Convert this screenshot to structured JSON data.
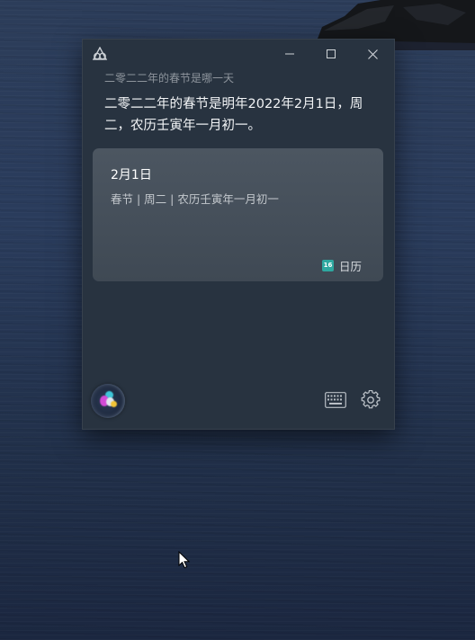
{
  "assistant": {
    "query": "二零二二年的春节是哪一天",
    "answer": "二零二二年的春节是明年2022年2月1日，周二，农历壬寅年一月初一。",
    "card": {
      "date": "2月1日",
      "detail": "春节 | 周二 | 农历壬寅年一月初一",
      "source_label": "日历",
      "source_icon_text": "16"
    }
  },
  "icons": {
    "app": "assistant-logo-icon",
    "minimize": "minimize-icon",
    "maximize": "maximize-icon",
    "close": "close-icon",
    "calendar": "calendar-icon",
    "voice": "voice-orb-icon",
    "keyboard": "keyboard-icon",
    "settings": "gear-icon"
  },
  "colors": {
    "window_bg": "#283340",
    "card_bg": "#4c5661",
    "calendar_accent": "#2ea8a0"
  }
}
